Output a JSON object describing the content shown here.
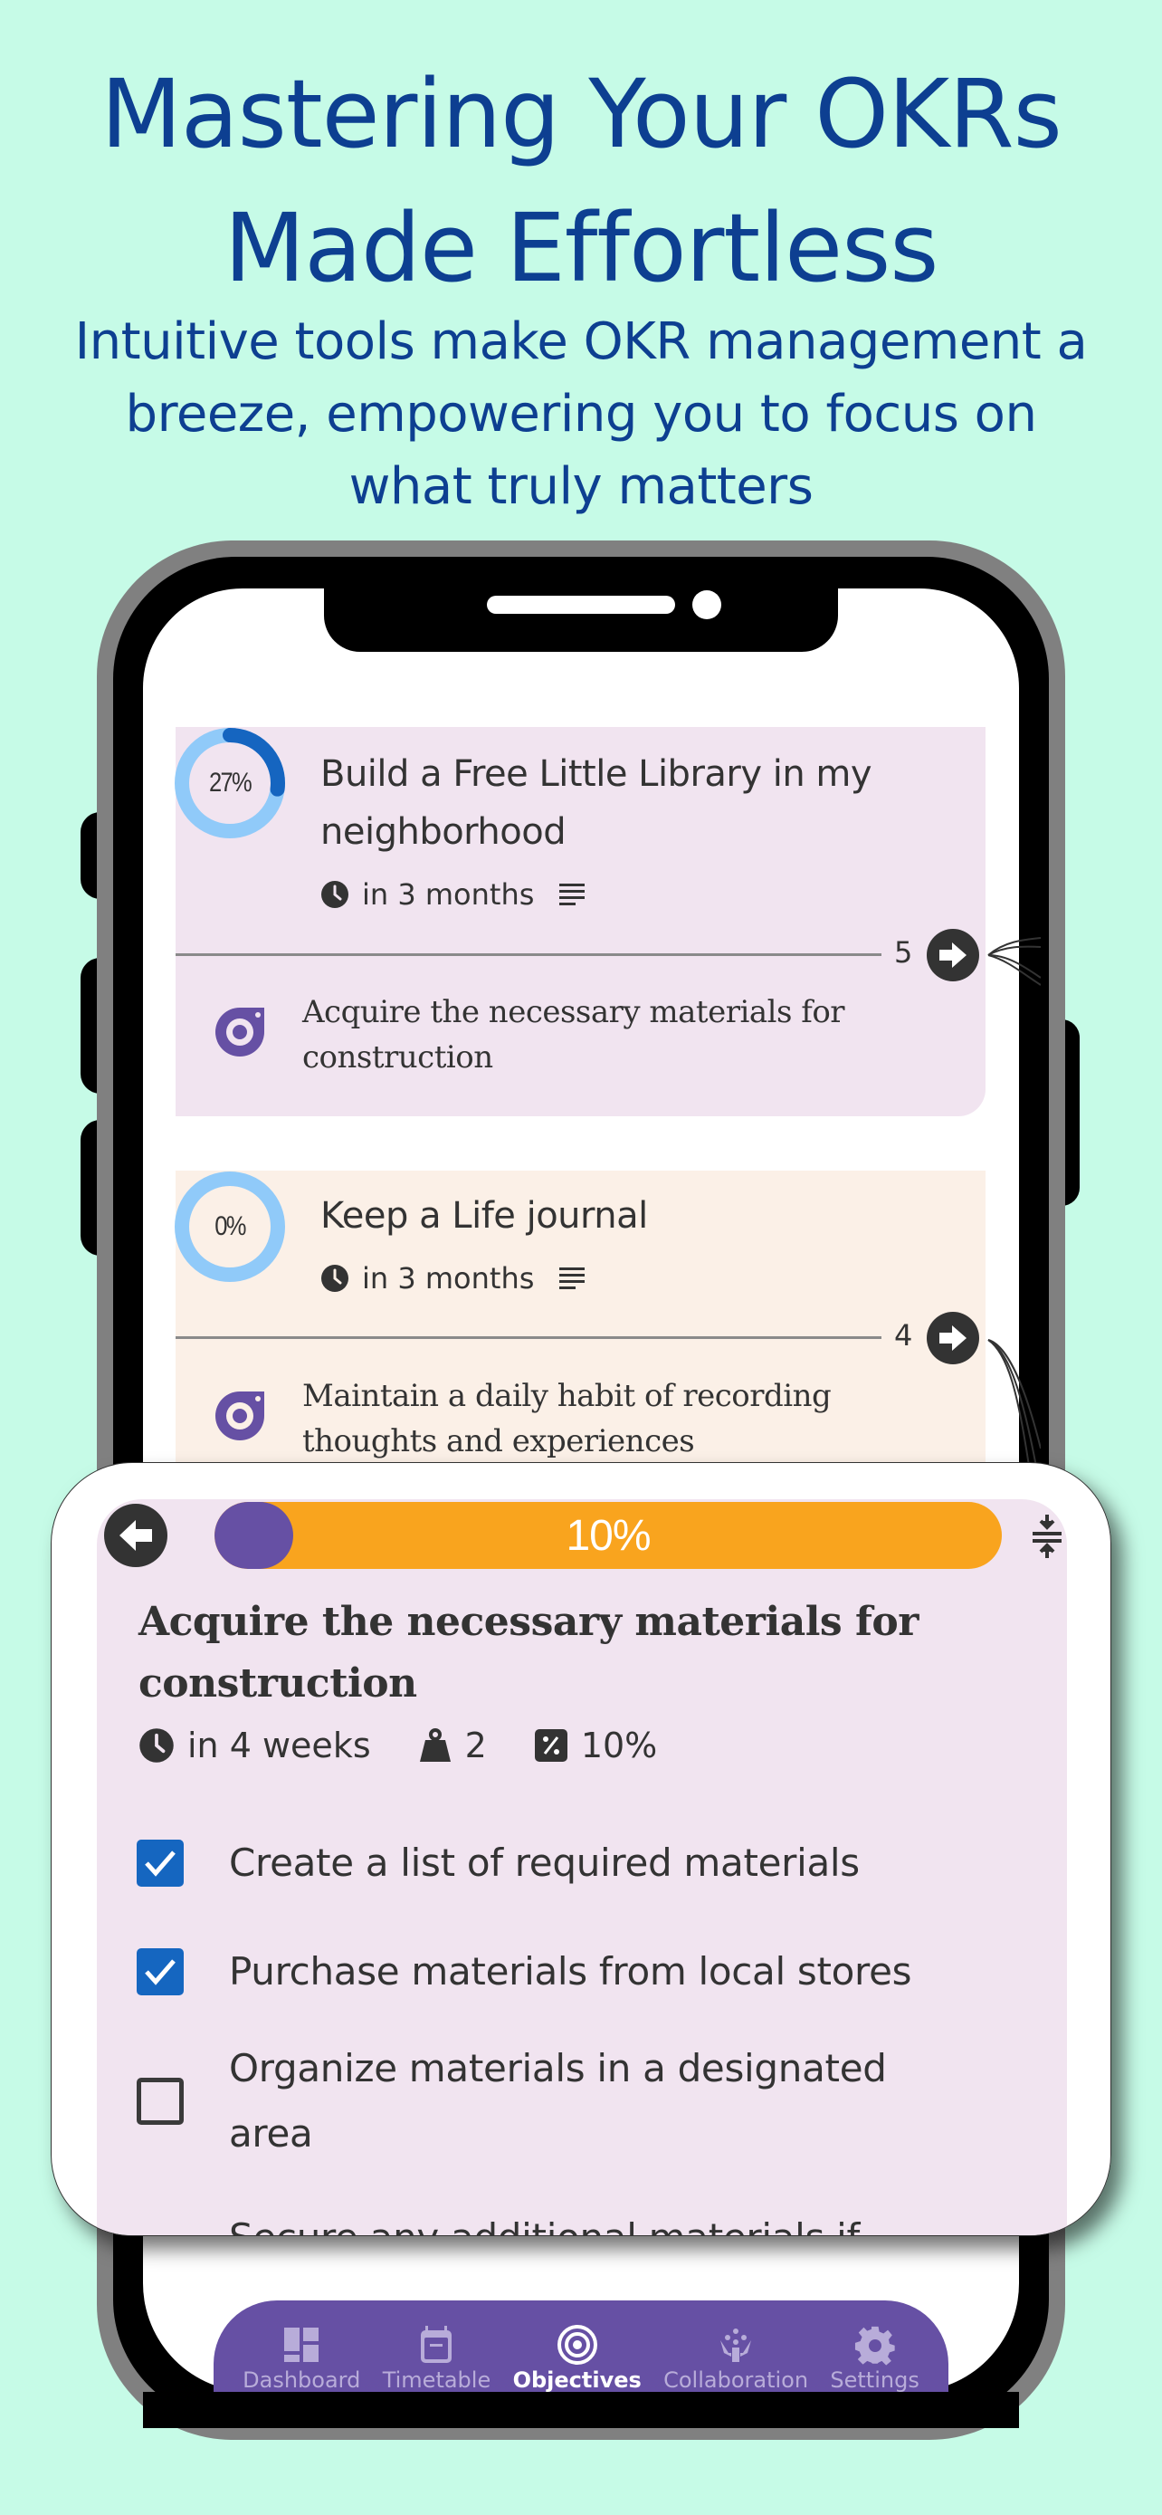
{
  "headline": {
    "line1": "Mastering Your OKRs",
    "line2": "Made Effortless"
  },
  "subline": {
    "line1": "Intuitive tools make OKR management a",
    "line2": "breeze, empowering you to focus on",
    "line3": "what truly matters"
  },
  "colors": {
    "background": "#c6fbe7",
    "headline": "#0d3f91",
    "accent_purple": "#6650a4",
    "progress_orange": "#f9a41e",
    "checkbox_blue": "#1566c0",
    "ring_light": "#90caf9",
    "ring_dark": "#1565c0",
    "card_pink": "#f1e4f0",
    "card_cream": "#fbf0e7"
  },
  "objectives": [
    {
      "progress_label": "27%",
      "progress": 0.27,
      "title_line1": "Build a Free Little Library in my",
      "title_line2": "neighborhood",
      "due": "in 3 months",
      "key_result_count": "5",
      "key_result": "Acquire the necessary materials for construction",
      "key_result_line1": "Acquire the necessary materials for",
      "key_result_line2": "construction"
    },
    {
      "progress_label": "0%",
      "progress": 0,
      "title_line1": "Keep a Life journal",
      "title_line2": "",
      "due": "in 3 months",
      "key_result_count": "4",
      "key_result": "Maintain a daily habit of recording thoughts and experiences",
      "key_result_line1": "Maintain a daily habit of recording",
      "key_result_line2": "thoughts and experiences"
    }
  ],
  "detail": {
    "progress_label": "10%",
    "progress": 0.1,
    "title_line1": "Acquire the necessary materials for",
    "title_line2": "construction",
    "due": "in 4 weeks",
    "weight": "2",
    "percent": "10%",
    "tasks": [
      {
        "label": "Create a list of required materials",
        "checked": true
      },
      {
        "label": "Purchase materials from local stores",
        "checked": true
      },
      {
        "label_line1": "Organize materials in a designated",
        "label_line2": "area",
        "checked": false
      },
      {
        "label": "Secure any additional materials if",
        "checked": false
      }
    ]
  },
  "nav": {
    "items": [
      {
        "label": "Dashboard",
        "icon": "dashboard-icon",
        "active": false
      },
      {
        "label": "Timetable",
        "icon": "calendar-icon",
        "active": false
      },
      {
        "label": "Objectives",
        "icon": "target-icon",
        "active": true
      },
      {
        "label": "Collaboration",
        "icon": "collaboration-icon",
        "active": false
      },
      {
        "label": "Settings",
        "icon": "gear-icon",
        "active": false
      }
    ]
  }
}
